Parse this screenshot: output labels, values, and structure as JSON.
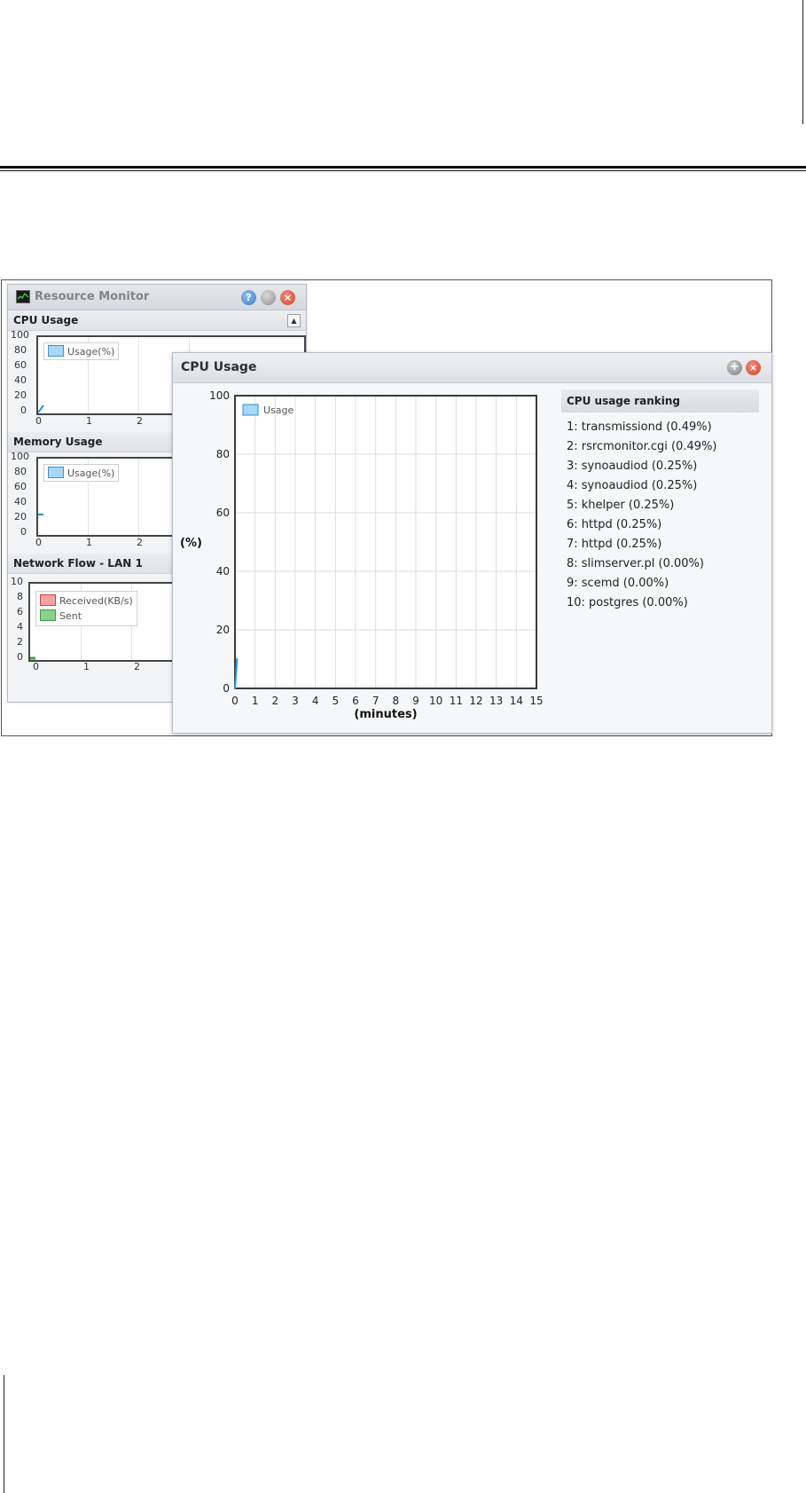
{
  "resource_monitor": {
    "title": "Resource Monitor",
    "help_glyph": "?",
    "close_glyph": "×",
    "collapse_glyph": "▲",
    "sections": [
      {
        "title": "CPU Usage"
      },
      {
        "title": "Memory Usage"
      },
      {
        "title": "Network Flow - LAN 1"
      }
    ],
    "cpu_mini": {
      "y_ticks": [
        "100",
        "80",
        "60",
        "40",
        "20",
        "0"
      ],
      "x_ticks": [
        "0",
        "1",
        "2"
      ],
      "legend": "Usage(%)"
    },
    "memory_mini": {
      "y_ticks": [
        "100",
        "80",
        "60",
        "40",
        "20",
        "0"
      ],
      "x_ticks": [
        "0",
        "1",
        "2"
      ],
      "legend": "Usage(%)"
    },
    "network_mini": {
      "y_ticks": [
        "10",
        "8",
        "6",
        "4",
        "2",
        "0"
      ],
      "x_ticks": [
        "0",
        "1",
        "2"
      ],
      "legend_received": "Received(KB/s)",
      "legend_sent": "Sent"
    }
  },
  "cpu_window": {
    "title": "CPU Usage",
    "add_glyph": "+",
    "close_glyph": "×",
    "ranking_title": "CPU usage ranking",
    "ranking": [
      "1: transmissiond (0.49%)",
      "2: rsrcmonitor.cgi (0.49%)",
      "3: synoaudiod (0.25%)",
      "4: synoaudiod (0.25%)",
      "5: khelper (0.25%)",
      "6: httpd (0.25%)",
      "7: httpd (0.25%)",
      "8: slimserver.pl (0.00%)",
      "9: scemd (0.00%)",
      "10: postgres (0.00%)"
    ]
  },
  "colors": {
    "usage_line": "#2d8fd0",
    "usage_fill": "#a8d8f5",
    "received": "#f6a3a3",
    "sent": "#8ed08e"
  },
  "chart_data": {
    "type": "line",
    "ylabel": "(%)",
    "xlabel": "(minutes)",
    "ylim": [
      0,
      100
    ],
    "xlim": [
      0,
      15
    ],
    "y_ticks": [
      0,
      20,
      40,
      60,
      80,
      100
    ],
    "x_ticks": [
      0,
      1,
      2,
      3,
      4,
      5,
      6,
      7,
      8,
      9,
      10,
      11,
      12,
      13,
      14,
      15
    ],
    "grid": true,
    "legend": "top-left",
    "series": [
      {
        "name": "Usage",
        "x": [
          0,
          0.1
        ],
        "values": [
          0,
          10
        ]
      }
    ]
  }
}
